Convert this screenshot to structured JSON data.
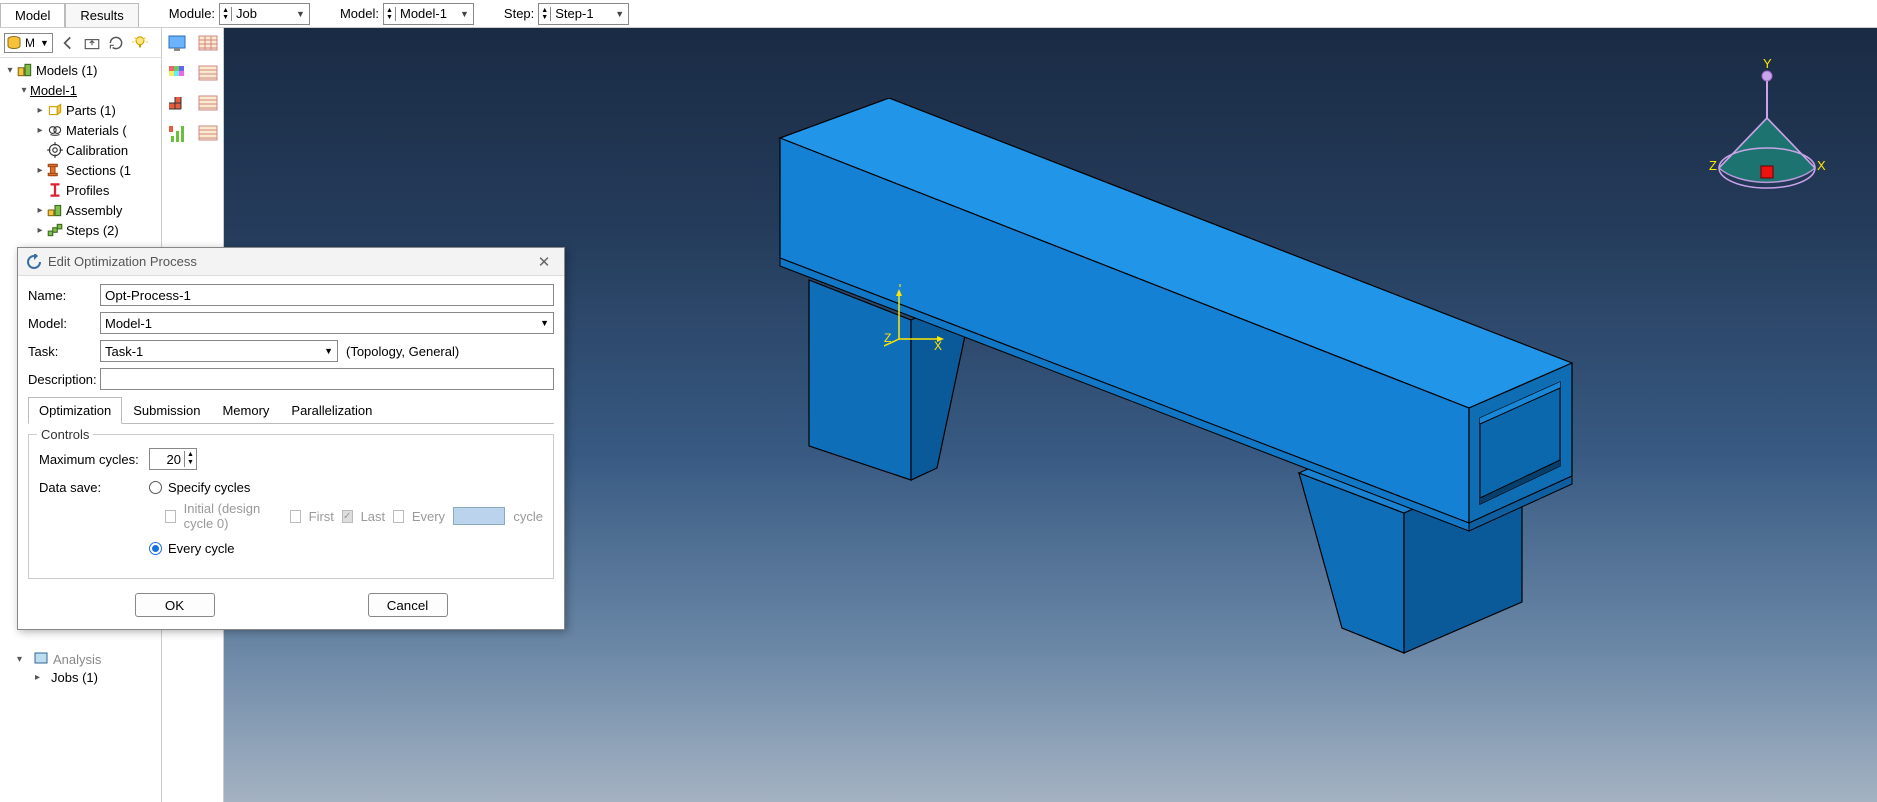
{
  "tabs": {
    "model": "Model",
    "results": "Results"
  },
  "selectors": {
    "module_label": "Module:",
    "module_value": "Job",
    "model_label": "Model:",
    "model_value": "Model-1",
    "step_label": "Step:",
    "step_value": "Step-1"
  },
  "mini_combo_value": "M",
  "tree": {
    "root": "Models (1)",
    "model": "Model-1",
    "parts": "Parts (1)",
    "materials": "Materials (",
    "calibration": "Calibration",
    "sections": "Sections (1",
    "profiles": "Profiles",
    "assembly": "Assembly",
    "steps": "Steps (2)"
  },
  "analysis_peek": {
    "analysis": "Analysis",
    "jobs": "Jobs (1)"
  },
  "axes": {
    "x": "X",
    "y": "Y",
    "z": "Z"
  },
  "dialog": {
    "title": "Edit Optimization Process",
    "name_label": "Name:",
    "name_value": "Opt-Process-1",
    "model_label": "Model:",
    "model_value": "Model-1",
    "task_label": "Task:",
    "task_value": "Task-1",
    "task_note": "(Topology, General)",
    "desc_label": "Description:",
    "desc_value": "",
    "tabs": {
      "opt": "Optimization",
      "sub": "Submission",
      "mem": "Memory",
      "par": "Parallelization"
    },
    "controls_legend": "Controls",
    "max_cycles_label": "Maximum cycles:",
    "max_cycles_value": "20",
    "data_save_label": "Data save:",
    "specify_cycles": "Specify cycles",
    "initial_label": "Initial (design cycle 0)",
    "first_label": "First",
    "last_label": "Last",
    "every_label": "Every",
    "cycle_label": "cycle",
    "every_cycle": "Every cycle",
    "ok": "OK",
    "cancel": "Cancel"
  }
}
